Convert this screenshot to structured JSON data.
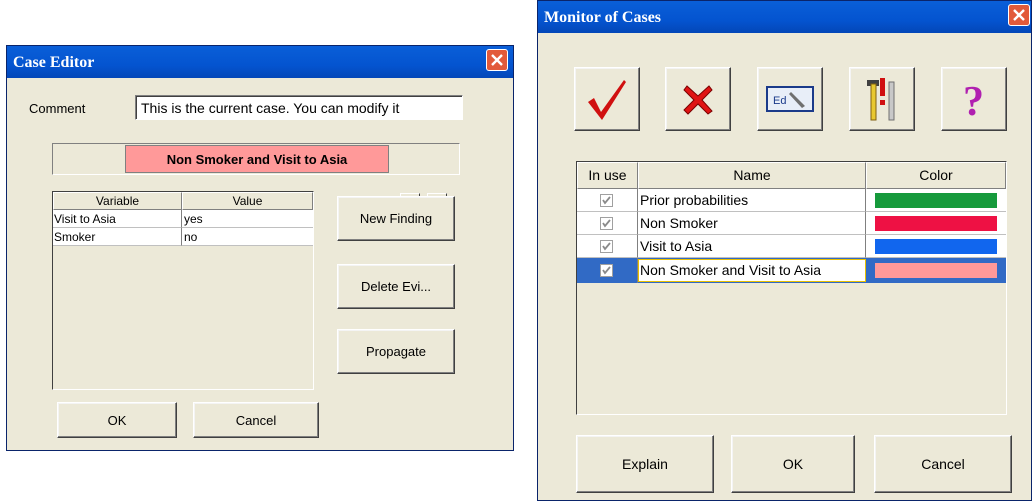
{
  "case_editor": {
    "title": "Case Editor",
    "comment_label": "Comment",
    "comment_value": "This is the current case. You can modify it",
    "case_name": "Non Smoker and Visit to Asia",
    "case_color": "#ff9999",
    "table": {
      "headers": [
        "Variable",
        "Value"
      ],
      "rows": [
        {
          "variable": "Visit to Asia",
          "value": "yes"
        },
        {
          "variable": "Smoker",
          "value": "no"
        }
      ]
    },
    "buttons": {
      "new_finding": "New Finding",
      "delete_evidence": "Delete Evi...",
      "propagate": "Propagate",
      "ok": "OK",
      "cancel": "Cancel"
    }
  },
  "monitor": {
    "title": "Monitor of Cases",
    "toolbar_icons": [
      "checkmark-icon",
      "red-x-icon",
      "edit-icon",
      "tools-icon",
      "help-icon"
    ],
    "table": {
      "headers": [
        "In use",
        "Name",
        "Color"
      ],
      "rows": [
        {
          "in_use": true,
          "name": "Prior probabilities",
          "color": "#169a3c"
        },
        {
          "in_use": true,
          "name": "Non Smoker",
          "color": "#ee1144"
        },
        {
          "in_use": true,
          "name": "Visit to Asia",
          "color": "#1166ee"
        },
        {
          "in_use": true,
          "name": "Non Smoker and Visit to Asia",
          "color": "#ff9999",
          "selected": true
        }
      ]
    },
    "buttons": {
      "explain": "Explain",
      "ok": "OK",
      "cancel": "Cancel"
    }
  }
}
